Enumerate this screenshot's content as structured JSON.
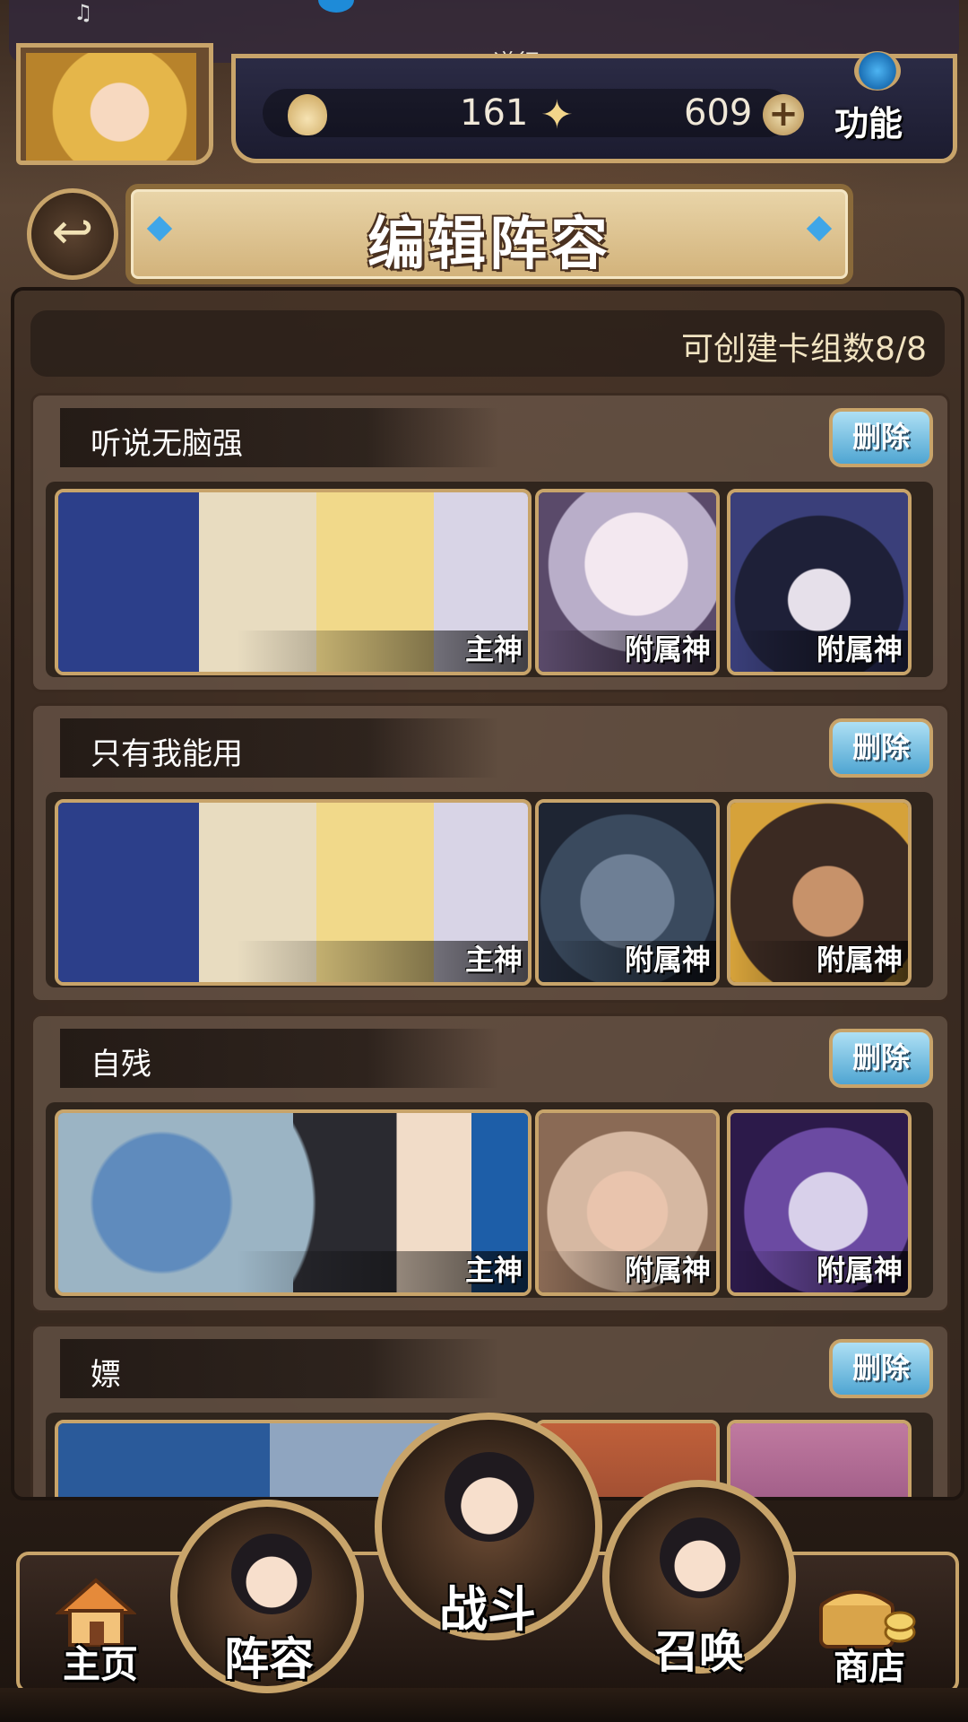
{
  "header": {
    "destination_partial": "道行",
    "resources": [
      {
        "icon": "flame-icon",
        "value": "161"
      },
      {
        "icon": "butterfly-icon",
        "value": "609"
      }
    ],
    "plus_glyph": "+",
    "function_label": "功能"
  },
  "title": {
    "back_glyph": "↩",
    "text": "编辑阵容"
  },
  "info": {
    "deck_count_text": "可创建卡组数8/8"
  },
  "decks": [
    {
      "name": "听说无脑强",
      "delete_label": "删除",
      "main_label": "主神",
      "sub1_label": "附属神",
      "sub2_label": "附属神",
      "colors": {
        "main": "#2c3f8a",
        "sub1": "#d8cfe0",
        "sub2": "#2a2f5a"
      }
    },
    {
      "name": "只有我能用",
      "delete_label": "删除",
      "main_label": "主神",
      "sub1_label": "附属神",
      "sub2_label": "附属神",
      "colors": {
        "main": "#2c3f8a",
        "sub1": "#4a5a72",
        "sub2": "#3b2a22"
      }
    },
    {
      "name": "自残",
      "delete_label": "删除",
      "main_label": "主神",
      "sub1_label": "附属神",
      "sub2_label": "附属神",
      "colors": {
        "main": "#9bb4c4",
        "sub1": "#d6b8a2",
        "sub2": "#4b2f7a"
      }
    },
    {
      "name": "嫖",
      "delete_label": "删除",
      "main_label": "",
      "sub1_label": "",
      "sub2_label": "",
      "colors": {
        "main": "#2a5a9a",
        "sub1": "#7a3a2a",
        "sub2": "#c07aa0"
      }
    }
  ],
  "nav": {
    "home": "主页",
    "lineup": "阵容",
    "battle": "战斗",
    "summon": "召唤",
    "shop": "商店"
  },
  "colors": {
    "frame_gold": "#c8a46a",
    "delete_blue": "#4fa5d2",
    "accent_gem": "#3fa6e8"
  }
}
